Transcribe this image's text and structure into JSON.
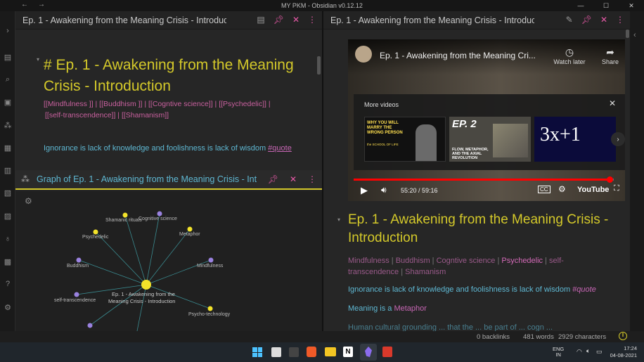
{
  "window": {
    "title": "MY PKM - Obsidian v0.12.12"
  },
  "left_note": {
    "tab_title": "Ep. 1 - Awakening from the Meaning Crisis - Introduc",
    "heading_line1": "# Ep. 1 - Awakening from the Meaning",
    "heading_line2": "Crisis - Introduction",
    "tags_line1": "[[Mindfulness ]] | [[Buddhism ]] | [[Cogntive science]] | [[Psychedelic]] |",
    "tags_line2": "[[self-transcendence]] | [[Shamanism]]",
    "body_text": "Ignorance is lack of knowledge and foolishness is lack of wisdom ",
    "body_tag": "#quote"
  },
  "graph": {
    "tab_title": "Graph of Ep. 1 - Awakening from the Meaning Crisis - Int",
    "nodes": [
      {
        "label": "Shamanic rituals"
      },
      {
        "label": "Cognitive science"
      },
      {
        "label": "Psychedelic"
      },
      {
        "label": "Metaphor"
      },
      {
        "label": "Buddhism"
      },
      {
        "label": "Mindfulness"
      },
      {
        "label": "self-transcendence"
      },
      {
        "label": "Ep. 1 - Awakening from the"
      },
      {
        "label": "Meaning Crisis - Introduction"
      },
      {
        "label": "Psycho-technology"
      }
    ]
  },
  "right_note": {
    "tab_title": "Ep. 1 - Awakening from the Meaning Crisis - Introduc",
    "heading": "Ep. 1 - Awakening from the Meaning Crisis - Introduction",
    "tags": [
      "Mindfulness",
      "Buddhism",
      "Cogntive science",
      "Psychedelic",
      "self-transcendence",
      "Shamanism"
    ],
    "body_text": "Ignorance is lack of knowledge and foolishness is lack of wisdom ",
    "body_tag": "#quote",
    "body_line2": "Meaning is a ",
    "body_link": "Metaphor",
    "body_line3": "Human cultural grounding ... that the ... be part of ... cogn ..."
  },
  "video": {
    "title": "Ep. 1 - Awakening from the Meaning Cri...",
    "watch_later": "Watch later",
    "share": "Share",
    "more_videos": "More videos",
    "thumb1_text": "WHY YOU WILL MARRY THE WRONG PERSON",
    "thumb1_sub": "the SCHOOL OF LIFE",
    "thumb2_text": "EP. 2",
    "thumb2_sub": "FLOW, METAPHOR, AND THE AXIAL REVOLUTION",
    "thumb3_text": "3x+1",
    "time": "55:20 / 59:16",
    "brand": "YouTube",
    "progress_fraction": 0.986
  },
  "status": {
    "backlinks": "0 backlinks",
    "words": "481 words",
    "characters": "2929 characters"
  },
  "taskbar": {
    "lang1": "ENG",
    "lang2": "IN",
    "time": "17:24",
    "date": "04-08-2021"
  },
  "colors": {
    "heading": "#d4c92a",
    "tag": "#c8609e",
    "text_cyan": "#5fb8d3",
    "accent_pink": "#e85aa8",
    "node_yellow": "#f3e32a",
    "node_purple": "#9a82e0"
  }
}
